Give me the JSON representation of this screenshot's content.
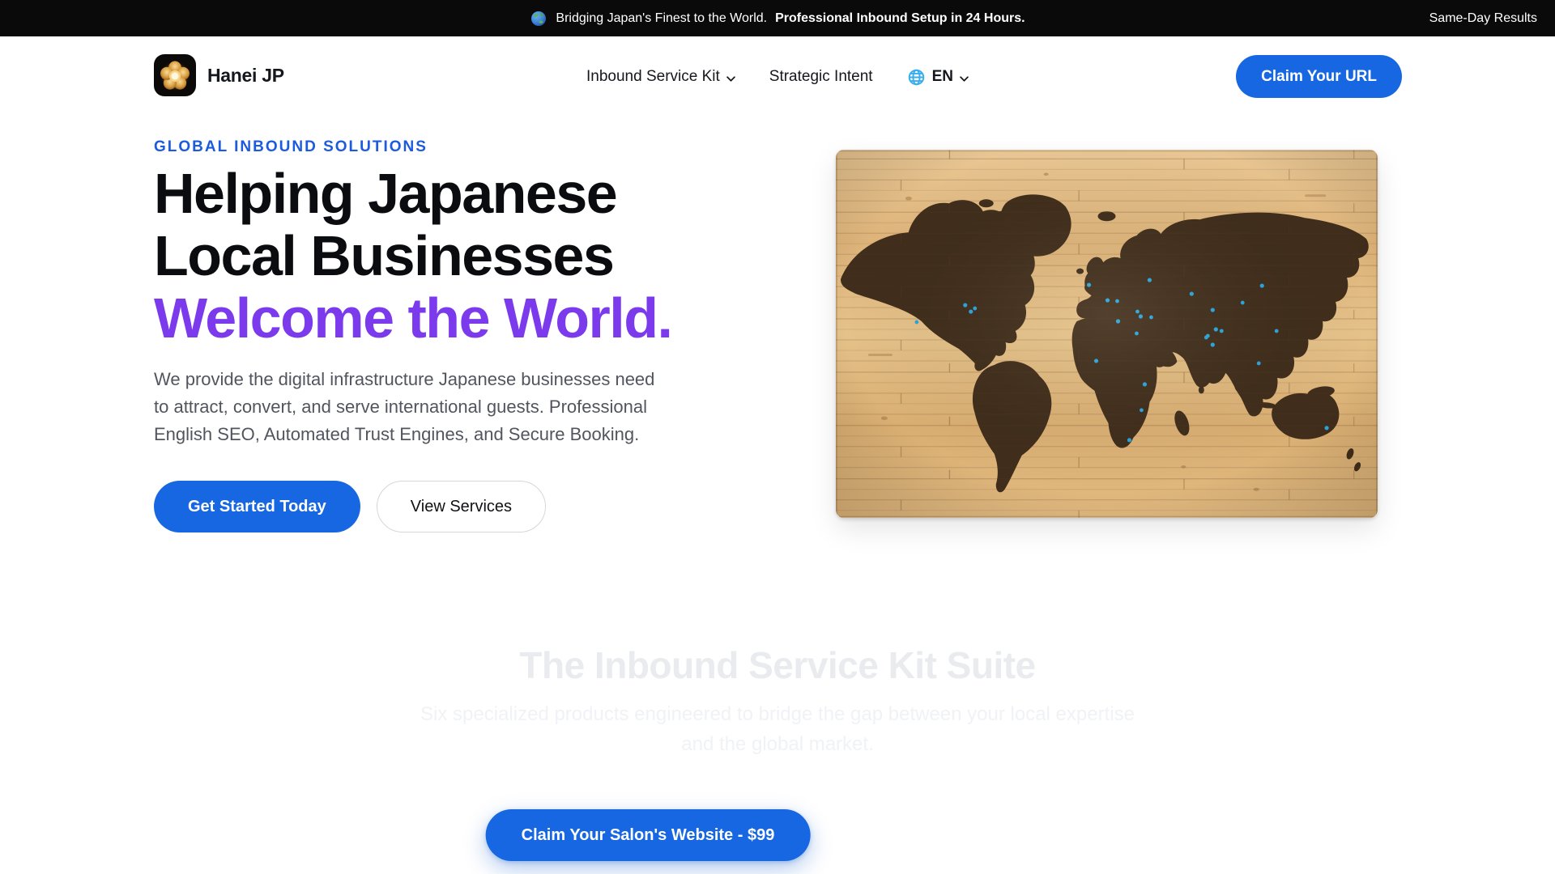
{
  "banner": {
    "message": "Bridging Japan's Finest to the World.",
    "message_bold": "Professional Inbound Setup in 24 Hours.",
    "right": "Same-Day Results"
  },
  "header": {
    "brand": "Hanei JP",
    "nav": {
      "services": "Inbound Service Kit",
      "intent": "Strategic Intent"
    },
    "language": "EN",
    "cta": "Claim Your URL"
  },
  "hero": {
    "eyebrow": "GLOBAL INBOUND SOLUTIONS",
    "title1": "Helping Japanese",
    "title2": "Local Businesses",
    "title3": "Welcome the World.",
    "description_lines": [
      "We provide the digital infrastructure Japanese businesses need",
      "to attract, convert, and serve international guests. Professional",
      "English SEO, Automated Trust Engines, and Secure Booking."
    ],
    "primary_cta": "Get Started Today",
    "secondary_cta": "View Services"
  },
  "suite": {
    "title": "The Inbound Service Kit Suite",
    "subtitle_lines": [
      "Six specialized products engineered to bridge the gap between your local expertise",
      "and the global market."
    ]
  },
  "floating_cta": "Claim Your Salon's Website - $99",
  "icons": {
    "banner_globe": "globe-asia-emoji",
    "logo": "golden-sakura-on-black-tile",
    "language_globe": "blue-wireframe-globe",
    "chevron": "chevron-down",
    "hero_image": "wooden-world-map-with-blue-pins"
  },
  "colors": {
    "banner_bg": "#0a0a0a",
    "primary_blue": "#1767e2",
    "eyebrow_blue": "#1d5ade",
    "accent_purple": "#7c3aed",
    "language_globe_blue": "#38aeee",
    "map_pin_blue": "#29a5dd"
  }
}
